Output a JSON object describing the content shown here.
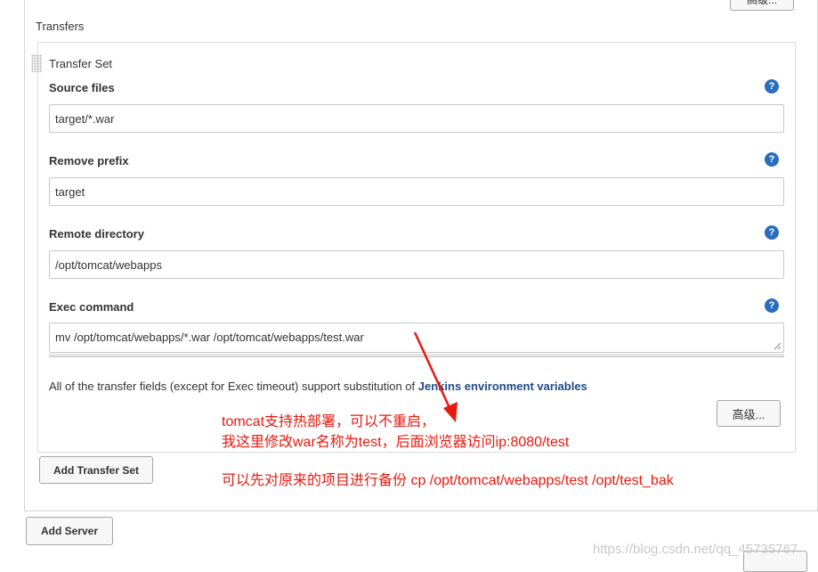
{
  "header": {
    "advanced_button_top_label": "高级..."
  },
  "transfers": {
    "title": "Transfers",
    "transfer_set_title": "Transfer Set",
    "fields": {
      "source_files": {
        "label": "Source files",
        "value": "target/*.war"
      },
      "remove_prefix": {
        "label": "Remove prefix",
        "value": "target"
      },
      "remote_directory": {
        "label": "Remote directory",
        "value": "/opt/tomcat/webapps"
      },
      "exec_command": {
        "label": "Exec command",
        "value": "mv /opt/tomcat/webapps/*.war /opt/tomcat/webapps/test.war"
      }
    },
    "help_icon_glyph": "?",
    "info_text": "All of the transfer fields (except for Exec timeout) support substitution of",
    "info_link": "Jenkins environment variables",
    "advanced_button_label": "高级...",
    "add_transfer_set_label": "Add Transfer Set"
  },
  "add_server_label": "Add Server",
  "annotations": {
    "line1": "tomcat支持热部署，可以不重启，",
    "line2": "我这里修改war名称为test，后面浏览器访问ip:8080/test",
    "line3": "可以先对原来的项目进行备份 cp /opt/tomcat/webapps/test /opt/test_bak",
    "color": "#e8190f"
  },
  "watermark": "https://blog.csdn.net/qq_45735767",
  "colors": {
    "help_icon": "#2a6ebb",
    "link": "#204a87"
  }
}
